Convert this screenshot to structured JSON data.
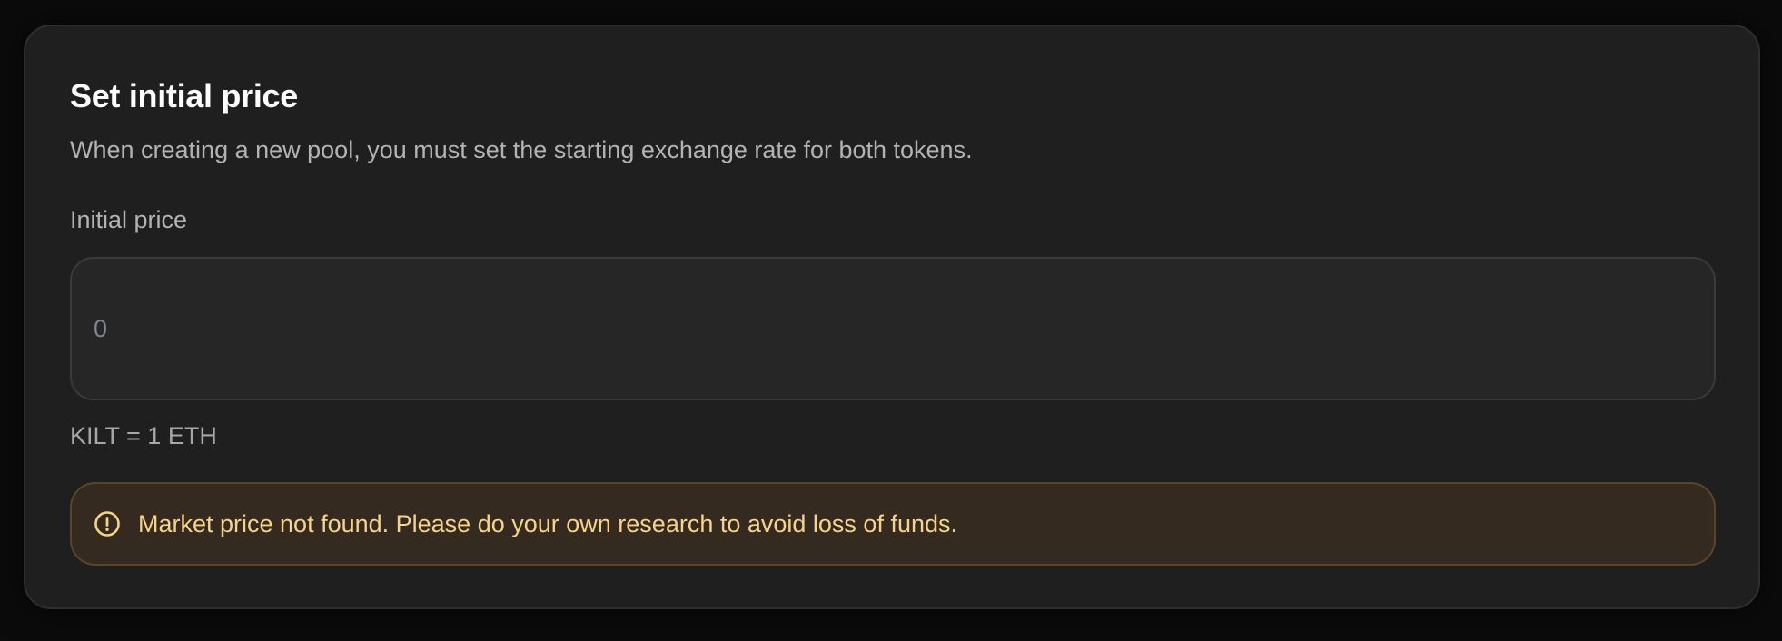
{
  "card": {
    "title": "Set initial price",
    "description": "When creating a new pool, you must set the starting exchange rate for both tokens."
  },
  "price_field": {
    "label": "Initial price",
    "value": "",
    "placeholder": "0"
  },
  "rate": {
    "text": "KILT = 1 ETH"
  },
  "warning": {
    "icon": "alert-circle-icon",
    "message": "Market price not found. Please do your own research to avoid loss of funds.",
    "color": "#f5d48a"
  }
}
